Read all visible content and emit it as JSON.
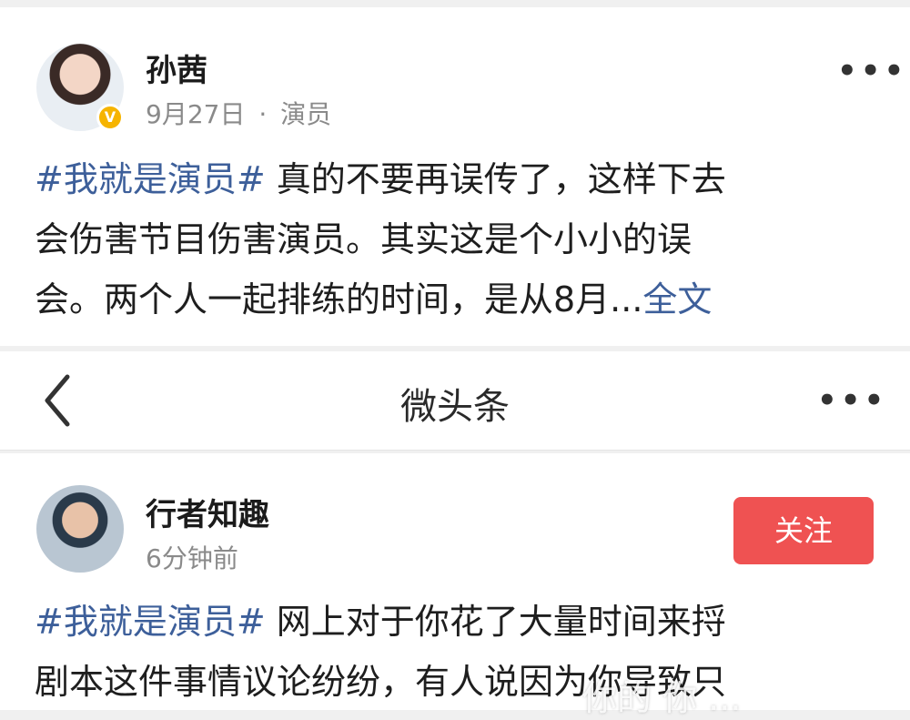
{
  "post1": {
    "author": "孙茜",
    "date": "9月27日",
    "separator": "·",
    "role": "演员",
    "verified_badge": "V",
    "hashtag": "#我就是演员#",
    "text_line1": " 真的不要再误传了，这样下去",
    "text_line2": "会伤害节目伤害演员。其实这是个小小的误",
    "text_line3": "会。两个人一起排练的时间，是从8月...",
    "full_text_link": "全文",
    "more_icon": "more-dots-icon"
  },
  "navbar": {
    "back_icon": "chevron-left-icon",
    "title": "微头条",
    "more_icon": "more-dots-icon"
  },
  "post2": {
    "author": "行者知趣",
    "time": "6分钟前",
    "follow_label": "关注",
    "hashtag": "#我就是演员#",
    "text_line1": " 网上对于你花了大量时间来捋",
    "text_line2": "剧本这件事情议论纷纷，有人说因为你导致只"
  },
  "watermark": "你的 你 ..."
}
